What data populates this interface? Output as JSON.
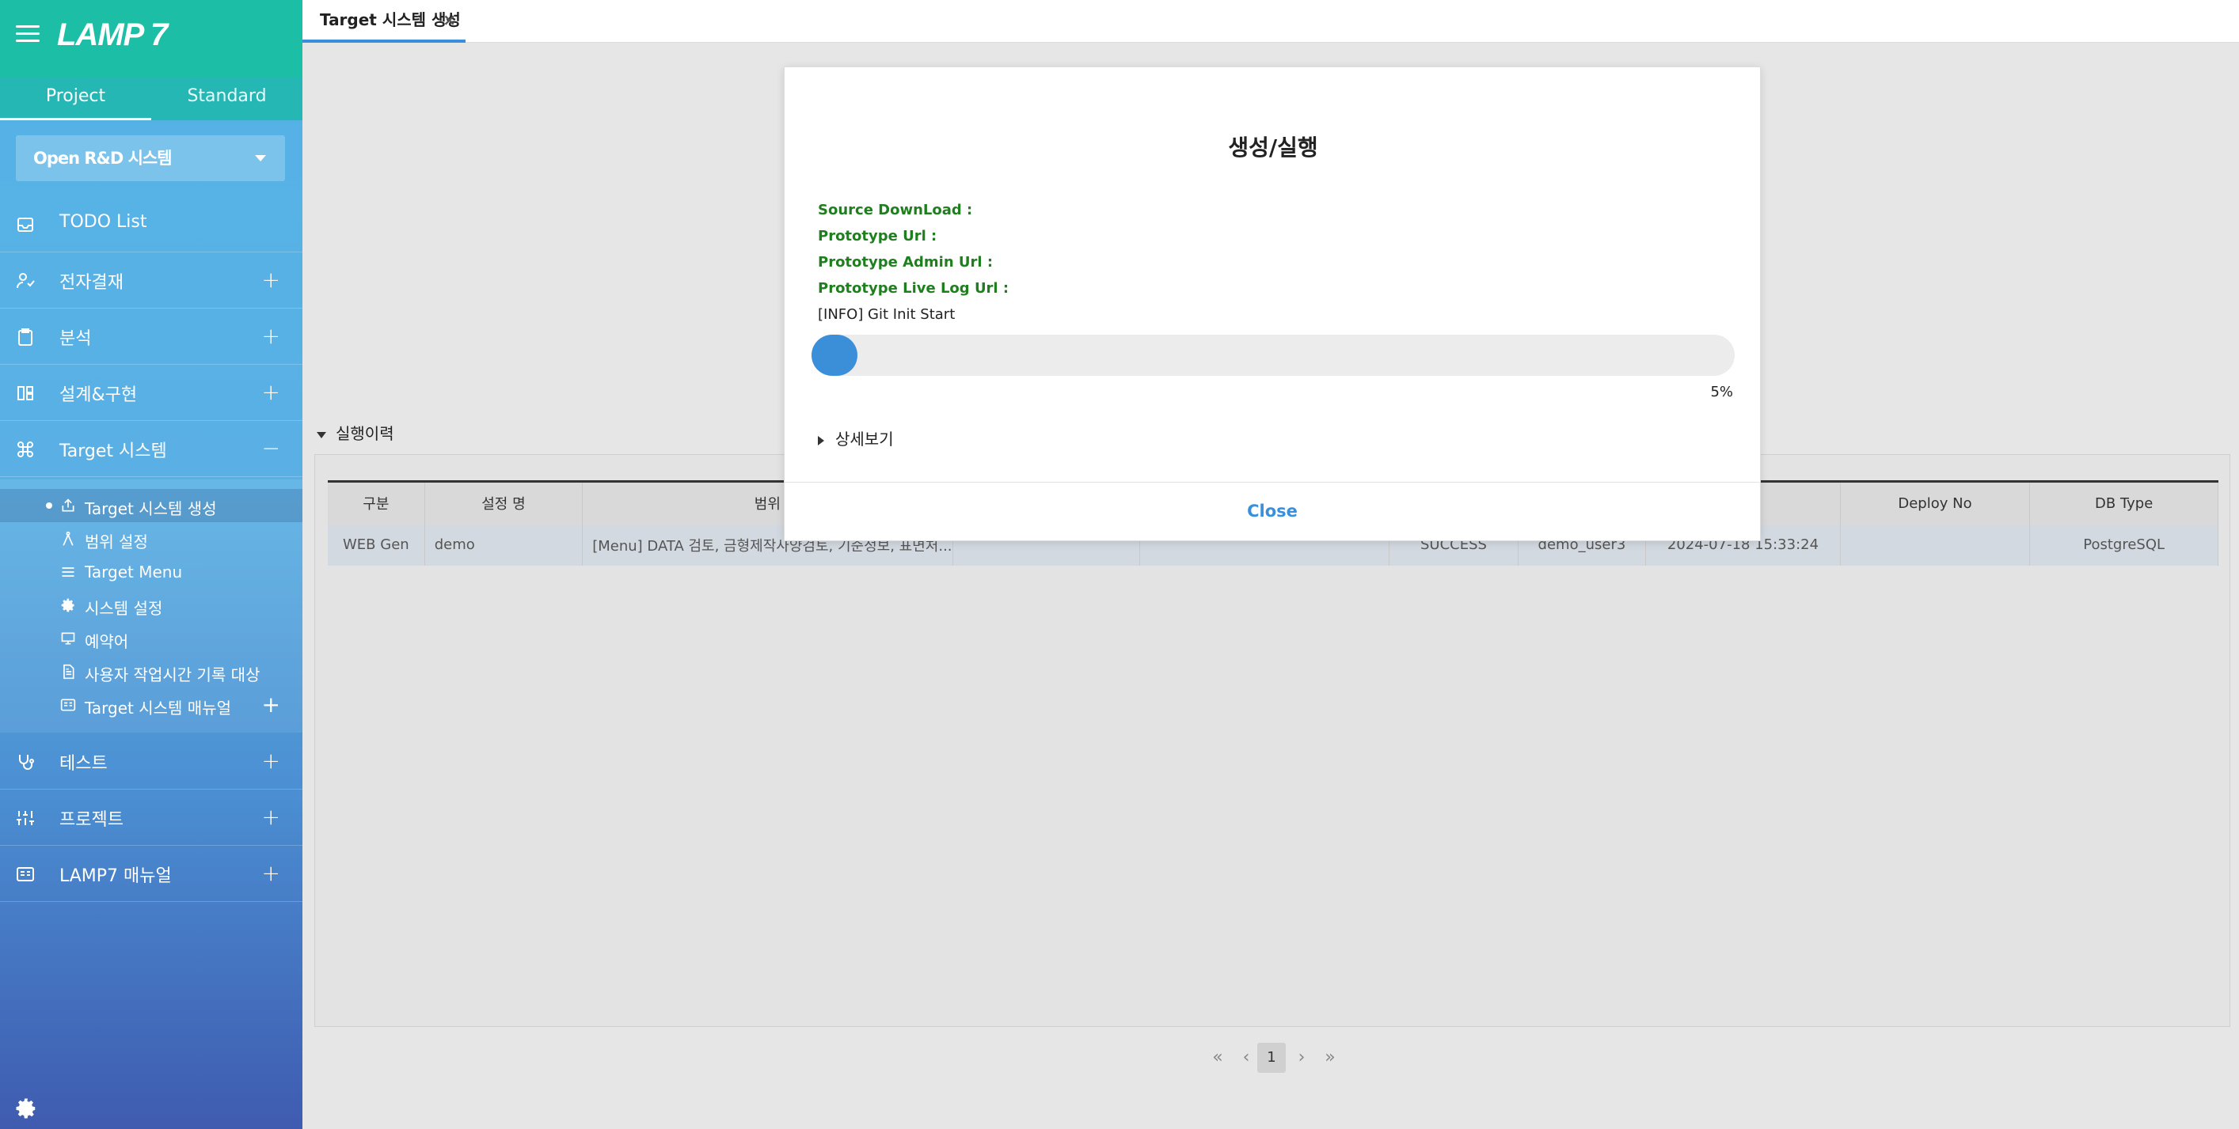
{
  "app": {
    "logo": "LAMP 7"
  },
  "sidebar": {
    "tabs": [
      {
        "label": "Project"
      },
      {
        "label": "Standard"
      }
    ],
    "project_select": "Open R&D 시스템",
    "nav": [
      {
        "label": "TODO List",
        "icon": "inbox-icon",
        "toggle": ""
      },
      {
        "label": "전자결재",
        "icon": "user-check-icon",
        "toggle": "+"
      },
      {
        "label": "분석",
        "icon": "clipboard-icon",
        "toggle": "+"
      },
      {
        "label": "설계&구현",
        "icon": "layout-icon",
        "toggle": "+"
      },
      {
        "label": "Target 시스템",
        "icon": "command-icon",
        "toggle": "−"
      },
      {
        "label": "테스트",
        "icon": "stethoscope-icon",
        "toggle": "+"
      },
      {
        "label": "프로젝트",
        "icon": "sliders-icon",
        "toggle": "+"
      },
      {
        "label": "LAMP7 매뉴얼",
        "icon": "manual-icon",
        "toggle": "+"
      }
    ],
    "sub_items": [
      {
        "label": "Target 시스템 생성",
        "icon": "share-icon"
      },
      {
        "label": "범위 설정",
        "icon": "compass-icon"
      },
      {
        "label": "Target Menu",
        "icon": "menu-icon"
      },
      {
        "label": "시스템 설정",
        "icon": "gear-icon"
      },
      {
        "label": "예약어",
        "icon": "monitor-icon"
      },
      {
        "label": "사용자 작업시간 기록 대상",
        "icon": "document-icon"
      },
      {
        "label": "Target 시스템 매뉴얼",
        "icon": "manual-icon",
        "toggle": "+"
      }
    ]
  },
  "topbar": {
    "tab_label": "Target 시스템 생성",
    "close": "×"
  },
  "history": {
    "title": "실행이력",
    "columns": [
      "구분",
      "설정 명",
      "범위",
      "",
      "",
      "",
      "",
      "",
      "Deploy No",
      "DB Type"
    ],
    "rows": [
      [
        "WEB Gen",
        "demo",
        "[Menu] DATA 검토, 금형제작사양검토, 기준정보, 표면처...",
        "",
        "",
        "SUCCESS",
        "demo_user3",
        "2024-07-18 15:33:24",
        "",
        "PostgreSQL"
      ]
    ]
  },
  "pager": {
    "first": "«",
    "prev": "‹",
    "current": "1",
    "next": "›",
    "last": "»"
  },
  "modal": {
    "title": "생성/실행",
    "source_download": "Source DownLoad :",
    "prototype_url": "Prototype Url :",
    "prototype_admin_url": "Prototype Admin Url :",
    "prototype_live_log_url": "Prototype Live Log Url :",
    "log": "[INFO] Git Init Start",
    "progress": 5,
    "progress_label": "5%",
    "details": "상세보기",
    "close": "Close"
  },
  "colors": {
    "accent": "#3a8fdc",
    "header_teal": "#1dbea6",
    "info_green": "#1f7f1f"
  }
}
